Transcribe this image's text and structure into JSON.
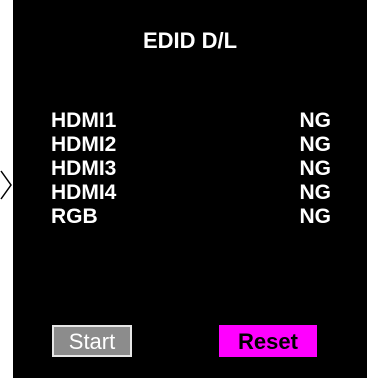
{
  "screen": {
    "title": "EDID D/L"
  },
  "ports": [
    {
      "name": "HDMI1",
      "status": "NG"
    },
    {
      "name": "HDMI2",
      "status": "NG"
    },
    {
      "name": "HDMI3",
      "status": "NG"
    },
    {
      "name": "HDMI4",
      "status": "NG"
    },
    {
      "name": "RGB",
      "status": "NG"
    }
  ],
  "buttons": {
    "start_label": "Start",
    "reset_label": "Reset"
  },
  "colors": {
    "panel_background": "#000000",
    "text": "#ffffff",
    "start_button": "#8c8c8c",
    "reset_button": "#ff00ff"
  },
  "icons": {
    "side_indicator": "chevron-right-icon"
  }
}
